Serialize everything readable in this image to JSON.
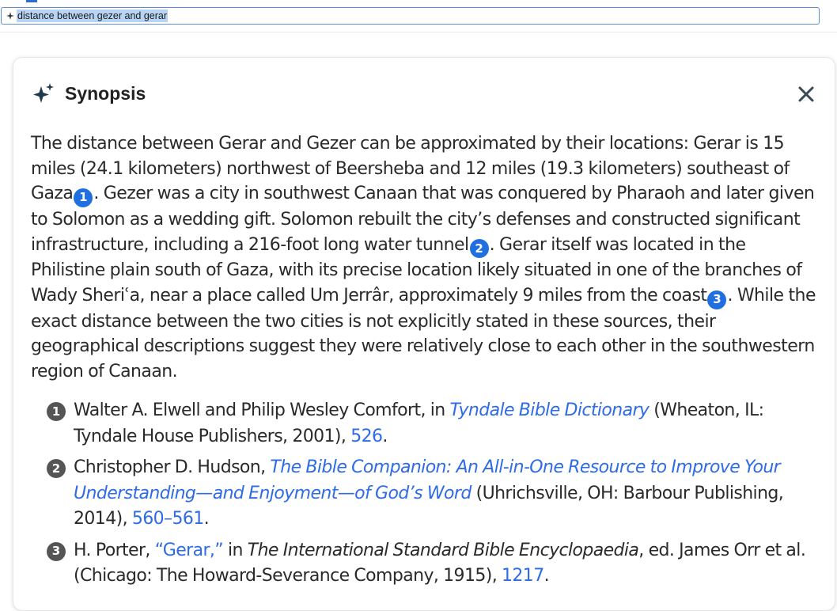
{
  "search": {
    "query": "distance between gezer and gerar"
  },
  "card": {
    "title": "Synopsis",
    "close_symbol": "✕"
  },
  "synopsis": {
    "segments": [
      "The distance between Gerar and Gezer can be approximated by their locations: Gerar is 15 miles (24.1 kilometers) northwest of Beersheba and 12 miles (19.3 kilometers) southeast of Gaza",
      ". Gezer was a city in southwest Canaan that was conquered by Pharaoh and later given to Solomon as a wedding gift. Solomon rebuilt the city’s defenses and constructed significant infrastructure, including a 216-foot long water tunnel",
      ". Gerar itself was located in the Philistine plain south of Gaza, with its precise location likely situated in one of the branches of Wady Sheriʿa, near a place called Um Jerrâr, approximately 9 miles from the coast",
      ". While the exact distance between the two cities is not explicitly stated in these sources, their geographical descriptions suggest they were relatively close to each other in the southwestern region of Canaan."
    ],
    "citations": [
      "1",
      "2",
      "3"
    ]
  },
  "references": [
    {
      "number": "1",
      "before": "Walter A. Elwell and Philip Wesley Comfort, in ",
      "title": "Tyndale Bible Dictionary",
      "after": " (Wheaton, IL: Tyndale House Publishers, 2001), ",
      "page": "526",
      "end": "."
    },
    {
      "number": "2",
      "before": "Christopher D. Hudson, ",
      "title": "The Bible Companion: An All-in-One Resource to Improve Your Understanding—and Enjoyment—of God’s Word",
      "after": " (Uhrichsville, OH: Barbour Publishing, 2014), ",
      "page": "560–561",
      "end": "."
    },
    {
      "number": "3",
      "before": "H. Porter, ",
      "article": "“Gerar,”",
      "mid": " in ",
      "title": "The International Standard Bible Encyclopaedia",
      "after": ", ed. James Orr et al. (Chicago: The Howard-Severance Company, 1915), ",
      "page": "1217",
      "end": "."
    }
  ],
  "colors": {
    "accent": "#1f6fe0",
    "link": "#2e6be6",
    "ref_badge": "#555555",
    "search_highlight": "#b8d4f5"
  }
}
